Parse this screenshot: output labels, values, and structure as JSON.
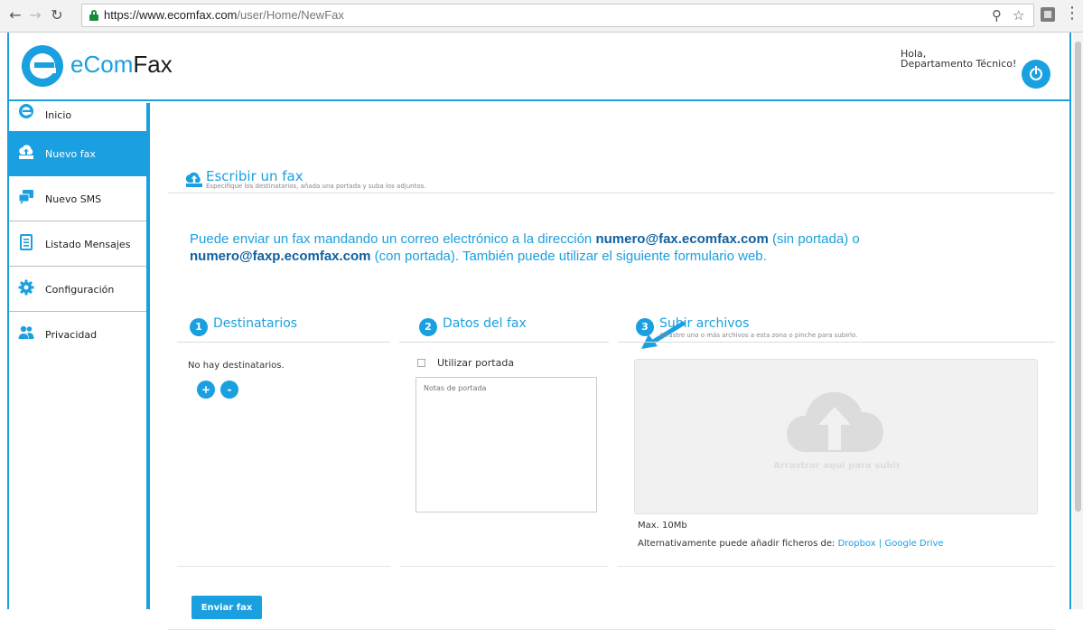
{
  "browser": {
    "url_host": "https://www.ecomfax.com",
    "url_path": "/user/Home/NewFax"
  },
  "header": {
    "logo_prefix": "eCom",
    "logo_suffix": "Fax",
    "greeting_line1": "Hola,",
    "greeting_line2": "Departamento Técnico!"
  },
  "sidebar": {
    "items": [
      {
        "label": "Inicio",
        "icon": "ecomfax-logo-icon",
        "active": false
      },
      {
        "label": "Nuevo fax",
        "icon": "upload-icon",
        "active": true
      },
      {
        "label": "Nuevo SMS",
        "icon": "chat-icon",
        "active": false
      },
      {
        "label": "Listado Mensajes",
        "icon": "list-icon",
        "active": false
      },
      {
        "label": "Configuración",
        "icon": "gear-icon",
        "active": false
      },
      {
        "label": "Privacidad",
        "icon": "users-icon",
        "active": false
      }
    ]
  },
  "page": {
    "title": "Escribir un fax",
    "subtitle": "Especifique los destinatarios, añada una portada y suba los adjuntos.",
    "intro_part1": "Puede enviar un fax mandando un correo electrónico a la dirección ",
    "intro_email1": "numero@fax.ecomfax.com",
    "intro_part2": " (sin portada) o ",
    "intro_email2": "numero@faxp.ecomfax.com",
    "intro_part3": " (con portada). También puede utilizar el siguiente formulario web."
  },
  "steps": {
    "recipients": {
      "number": "1",
      "title": "Destinatarios",
      "empty_text": "No hay destinatarios.",
      "add_label": "+",
      "remove_label": "-"
    },
    "fax_data": {
      "number": "2",
      "title": "Datos del fax",
      "cover_label": "Utilizar portada",
      "cover_checked": false,
      "notes_placeholder": "Notas de portada"
    },
    "upload": {
      "number": "3",
      "title": "Subir archivos",
      "subtitle": "Arrastre uno o más archivos a esta zona o pinche para subirlo.",
      "drop_text": "Arrastrar aquí para subir",
      "max_size": "Max. 10Mb",
      "alt_text": "Alternativamente puede añadir ficheros de: ",
      "dropbox_label": "Dropbox",
      "separator": "|",
      "gdrive_label": "Google Drive"
    }
  },
  "actions": {
    "send_label": "Enviar fax"
  },
  "colors": {
    "accent": "#1aa0e0",
    "email_highlight": "#1060a0"
  }
}
